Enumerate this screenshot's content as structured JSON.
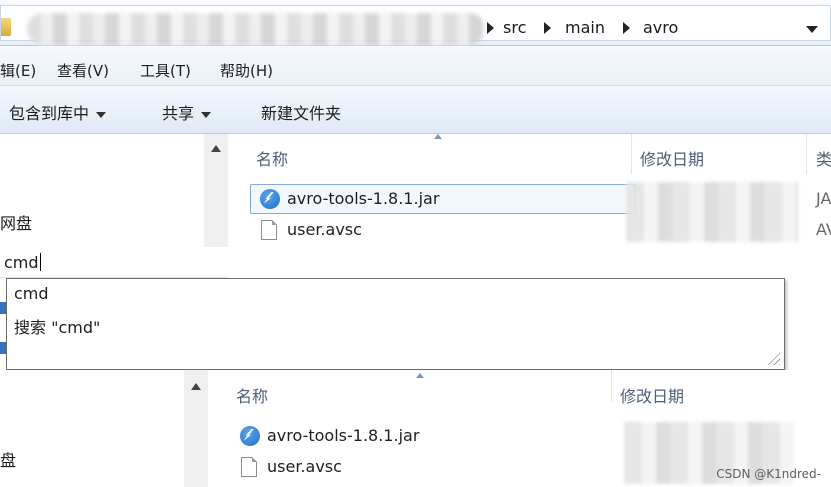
{
  "address_bar": {
    "crumbs": [
      "src",
      "main",
      "avro"
    ]
  },
  "menu": {
    "items": [
      "辑(E)",
      "查看(V)",
      "工具(T)",
      "帮助(H)"
    ]
  },
  "toolbar": {
    "include_library": "包含到库中",
    "share": "共享",
    "new_folder": "新建文件夹"
  },
  "nav_pane": {
    "visible_labels": [
      "网盘",
      "盘"
    ]
  },
  "file_list": {
    "columns": {
      "name": "名称",
      "modified": "修改日期",
      "type_partial": "类"
    },
    "files": [
      {
        "name": "avro-tools-1.8.1.jar",
        "icon": "jar-icon",
        "type_partial": "JA"
      },
      {
        "name": "user.avsc",
        "icon": "document-icon",
        "type_partial": "AV"
      }
    ]
  },
  "search_box": {
    "value": "cmd"
  },
  "autocomplete": {
    "items": [
      "cmd",
      "搜索 \"cmd\""
    ]
  },
  "watermark": "CSDN @K1ndred-"
}
